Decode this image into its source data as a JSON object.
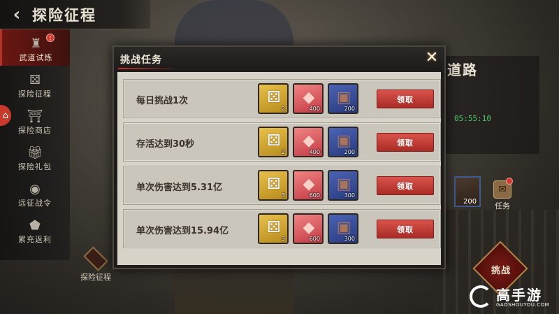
{
  "header": {
    "back_icon": "back-chevron-icon",
    "title": "探险征程"
  },
  "sidebar": {
    "items": [
      {
        "label": "武道试炼",
        "icon": "tower-icon",
        "active": true,
        "badge": "!"
      },
      {
        "label": "探险征程",
        "icon": "dice-icon"
      },
      {
        "label": "探险商店",
        "icon": "shop-icon"
      },
      {
        "label": "探险礼包",
        "icon": "gift-icon"
      },
      {
        "label": "远征战令",
        "icon": "token-icon"
      },
      {
        "label": "累充返利",
        "icon": "rebate-icon"
      }
    ],
    "home_icon": "home-icon"
  },
  "bottom_badge": {
    "label": "探险征程"
  },
  "right": {
    "title": "道路",
    "timer": "05:55:10",
    "box_count": "200",
    "task_label": "任务",
    "challenge_label": "挑战"
  },
  "modal": {
    "title": "挑战任务",
    "close_icon": "crossed-swords-close-icon",
    "tasks": [
      {
        "name": "每日挑战1次",
        "dice": "2",
        "gem": "400",
        "box": "200",
        "claim": "领取"
      },
      {
        "name": "存活达到30秒",
        "dice": "2",
        "gem": "400",
        "box": "200",
        "claim": "领取"
      },
      {
        "name": "单次伤害达到5.31亿",
        "dice": "3",
        "gem": "600",
        "box": "300",
        "claim": "领取"
      },
      {
        "name": "单次伤害达到15.94亿",
        "dice": "3",
        "gem": "600",
        "box": "300",
        "claim": "领取"
      }
    ]
  },
  "watermark": {
    "text": "高手游",
    "sub": "GAOSHOUYOU.COM"
  },
  "colors": {
    "accent_red": "#c9302a",
    "panel_bg": "#d8d3c9",
    "timer_green": "#4ecb6a"
  }
}
